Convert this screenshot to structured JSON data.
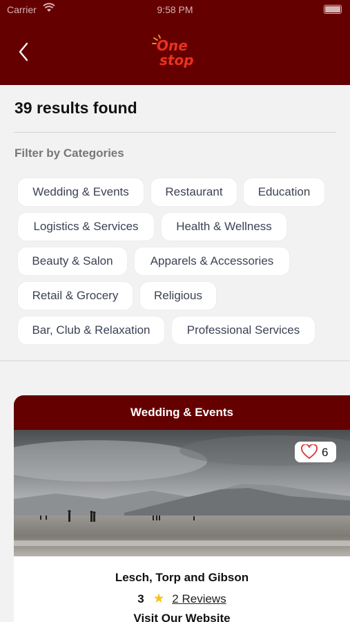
{
  "status_bar": {
    "carrier": "Carrier",
    "time": "9:58 PM"
  },
  "header": {
    "logo_line1": "One",
    "logo_line2": "stop",
    "back_icon": "chevron-left-icon"
  },
  "results": {
    "title": "39 results found"
  },
  "filters": {
    "title": "Filter by Categories",
    "categories": [
      "Wedding & Events",
      "Restaurant",
      "Education",
      "Logistics & Services",
      "Health & Wellness",
      "Beauty & Salon",
      "Apparels & Accessories",
      "Retail & Grocery",
      "Religious",
      "Bar, Club & Relaxation",
      "Professional Services"
    ]
  },
  "card": {
    "category": "Wedding & Events",
    "likes": "6",
    "name": "Lesch, Torp and Gibson",
    "rating": "3",
    "reviews": "2 Reviews",
    "website": "Visit Our Website"
  },
  "colors": {
    "brand": "#650000",
    "logo": "#e8321e",
    "star": "#f5c518",
    "chip_text": "#3b4254"
  }
}
